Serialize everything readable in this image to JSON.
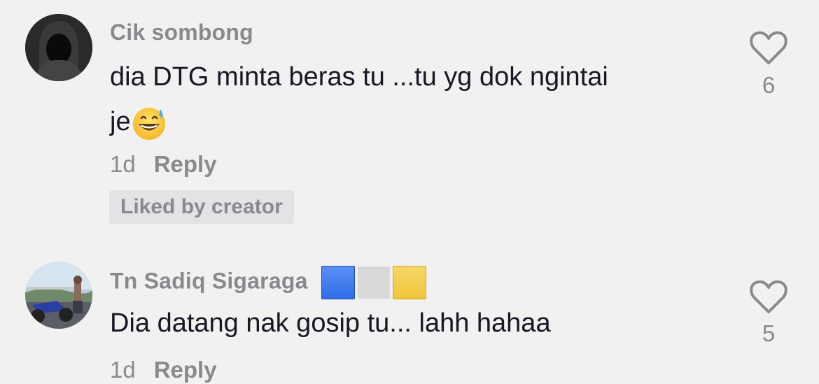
{
  "comments": [
    {
      "username": "Cik sombong",
      "text_line1": "dia DTG minta beras tu ...tu yg dok ngintai",
      "text_line2": "je",
      "emoji": "grinning-sweat-emoji",
      "age": "1d",
      "reply_label": "Reply",
      "badge": "Liked by creator",
      "likes": "6",
      "avatar_icon": "hooded-figure-avatar"
    },
    {
      "username": "Tn Sadiq Sigaraga",
      "name_emoji_colors": [
        "#2f6ee8",
        "#d9d9d9",
        "#f0c63a"
      ],
      "text": "Dia datang nak gosip tu... lahh hahaa",
      "age": "1d",
      "reply_label": "Reply",
      "likes": "5",
      "avatar_icon": "motorcycle-photo-avatar"
    }
  ],
  "colors": {
    "background": "#f1f1f2",
    "muted_text": "#8a8a8e",
    "primary_text": "#161823",
    "badge_bg": "#e3e3e5"
  }
}
